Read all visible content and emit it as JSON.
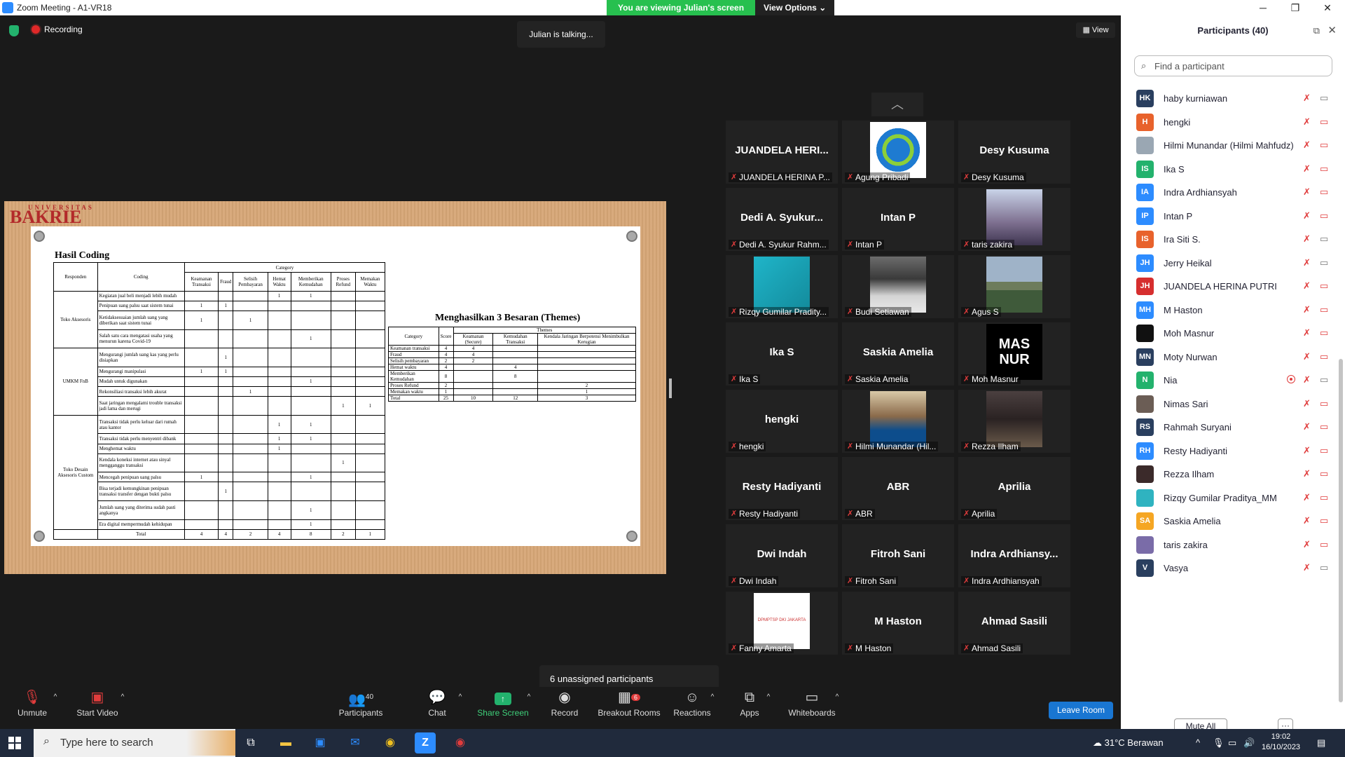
{
  "window": {
    "title": "Zoom Meeting - A1-VR18",
    "minimize": "─",
    "maximize": "❐",
    "close": "✕"
  },
  "banner": {
    "message": "You are viewing Julian's screen",
    "options_label": "View Options",
    "chevron": "⌄"
  },
  "topbar": {
    "recording": "Recording",
    "talking": "Julian is talking...",
    "view": "View"
  },
  "shared_screen": {
    "brand_small": "UNIVERSITAS",
    "brand_large": "BAKRIE",
    "coding_title": "Hasil Coding",
    "coding_headers": {
      "responden": "Responden",
      "coding": "Coding",
      "category": "Category"
    },
    "categories": [
      "Keamanan Transaksi",
      "Fraud",
      "Selisih Pembayaran",
      "Hemat Waktu",
      "Memberikan Kemudahan",
      "Proses Refund",
      "Memakan Waktu"
    ],
    "groups": [
      {
        "name": "Toko Aksesoris",
        "rows": [
          {
            "code": "Kegiatan jual beli menjadi lebih mudah",
            "v": [
              "",
              "",
              "",
              "1",
              "1",
              "",
              ""
            ]
          },
          {
            "code": "Penipuan uang palsu saat sistem tunai",
            "v": [
              "1",
              "1",
              "",
              "",
              "",
              "",
              ""
            ]
          },
          {
            "code": "Ketidaksesuaian jumlah uang yang diberikan saat sistem tunai",
            "v": [
              "1",
              "",
              "1",
              "",
              "",
              "",
              ""
            ]
          },
          {
            "code": "Salah satu cara mengatasi usaha yang menurun karena Covid-19",
            "v": [
              "",
              "",
              "",
              "",
              "1",
              "",
              ""
            ]
          }
        ]
      },
      {
        "name": "UMKM FnB",
        "rows": [
          {
            "code": "Mengurangi jumlah uang kas yang perlu disiapkan",
            "v": [
              "",
              "1",
              "",
              "",
              "",
              "",
              ""
            ]
          },
          {
            "code": "Mengurangi manipulasi",
            "v": [
              "1",
              "1",
              "",
              "",
              "",
              "",
              ""
            ]
          },
          {
            "code": "Mudah untuk digunakan",
            "v": [
              "",
              "",
              "",
              "",
              "1",
              "",
              ""
            ]
          },
          {
            "code": "Rekonsiliasi transaksi lebih akurat",
            "v": [
              "",
              "",
              "1",
              "",
              "",
              "",
              ""
            ]
          },
          {
            "code": "Saat jaringan mengalami trouble transaksi jadi lama dan merugi",
            "v": [
              "",
              "",
              "",
              "",
              "",
              "1",
              "1"
            ]
          }
        ]
      },
      {
        "name": "Toko Desain Aksesoris Custom",
        "rows": [
          {
            "code": "Transaksi tidak perlu keluar dari rumah atau kantor",
            "v": [
              "",
              "",
              "",
              "1",
              "1",
              "",
              ""
            ]
          },
          {
            "code": "Transaksi tidak perlu menyentri dibank",
            "v": [
              "",
              "",
              "",
              "1",
              "1",
              "",
              ""
            ]
          },
          {
            "code": "Menghemat waktu",
            "v": [
              "",
              "",
              "",
              "1",
              "",
              "",
              ""
            ]
          },
          {
            "code": "Kendala koneksi internet atau sinyal mengganggu transaksi",
            "v": [
              "",
              "",
              "",
              "",
              "",
              "1",
              ""
            ]
          },
          {
            "code": "Mencegah penipuan uang palsu",
            "v": [
              "1",
              "",
              "",
              "",
              "1",
              "",
              ""
            ]
          },
          {
            "code": "Bisa terjadi kemungkinan penipuan transaksi transfer dengan bukti palsu",
            "v": [
              "",
              "1",
              "",
              "",
              "",
              "",
              ""
            ]
          },
          {
            "code": "Jumlah uang yang diterima sudah pasti angkanya",
            "v": [
              "",
              "",
              "",
              "",
              "1",
              "",
              ""
            ]
          },
          {
            "code": "Era digital mempermudah kehidupan",
            "v": [
              "",
              "",
              "",
              "",
              "1",
              "",
              ""
            ]
          }
        ]
      }
    ],
    "total_label": "Total",
    "totals": [
      "4",
      "4",
      "2",
      "4",
      "8",
      "2",
      "1"
    ],
    "themes_title": "Menghasilkan 3 Besaran (Themes)",
    "themes_headers": {
      "category": "Category",
      "score": "Score",
      "themes": "Themes",
      "t1": "Keamanan (Secure)",
      "t2": "Kemudahan Transaksi",
      "t3": "Kendala Jaringan Berpotensi Menimbulkan Kerugian"
    },
    "themes_rows": [
      {
        "c": "Keamanan transaksi",
        "s": "4",
        "a": "4",
        "b": "",
        "d": ""
      },
      {
        "c": "Fraud",
        "s": "4",
        "a": "4",
        "b": "",
        "d": ""
      },
      {
        "c": "Selisih pembayaran",
        "s": "2",
        "a": "2",
        "b": "",
        "d": ""
      },
      {
        "c": "Hemat waktu",
        "s": "4",
        "a": "",
        "b": "4",
        "d": ""
      },
      {
        "c": "Memberikan Kemudahan",
        "s": "8",
        "a": "",
        "b": "8",
        "d": ""
      },
      {
        "c": "Proses Refund",
        "s": "2",
        "a": "",
        "b": "",
        "d": "2"
      },
      {
        "c": "Memakan waktu",
        "s": "1",
        "a": "",
        "b": "",
        "d": "1"
      },
      {
        "c": "Total",
        "s": "25",
        "a": "10",
        "b": "12",
        "d": "3"
      }
    ]
  },
  "tiles": [
    {
      "big": "JUANDELA HERI...",
      "label": "JUANDELA HERINA P...",
      "thumb": ""
    },
    {
      "big": "",
      "label": "Agung Pribadi",
      "thumb": "globe"
    },
    {
      "big": "Desy Kusuma",
      "label": "Desy Kusuma",
      "thumb": ""
    },
    {
      "big": "Dedi A. Syukur...",
      "label": "Dedi A. Syukur Rahm...",
      "thumb": ""
    },
    {
      "big": "Intan P",
      "label": "Intan P",
      "thumb": ""
    },
    {
      "big": "",
      "label": "taris zakira",
      "thumb": "group"
    },
    {
      "big": "",
      "label": "Rizqy Gumilar Pradity...",
      "thumb": "teal"
    },
    {
      "big": "",
      "label": "Budi Setiawan",
      "thumb": "person"
    },
    {
      "big": "",
      "label": "Agus S",
      "thumb": "field"
    },
    {
      "big": "Ika S",
      "label": "Ika S",
      "thumb": ""
    },
    {
      "big": "Saskia Amelia",
      "label": "Saskia Amelia",
      "thumb": ""
    },
    {
      "big": "",
      "label": "Moh Masnur",
      "thumb": "masnur"
    },
    {
      "big": "hengki",
      "label": "hengki",
      "thumb": ""
    },
    {
      "big": "",
      "label": "Hilmi Munandar (Hil...",
      "thumb": "person2"
    },
    {
      "big": "",
      "label": "Rezza Ilham",
      "thumb": "car"
    },
    {
      "big": "Resty Hadiyanti",
      "label": "Resty Hadiyanti",
      "thumb": ""
    },
    {
      "big": "ABR",
      "label": "ABR",
      "thumb": ""
    },
    {
      "big": "Aprilia",
      "label": "Aprilia",
      "thumb": ""
    },
    {
      "big": "Dwi Indah",
      "label": "Dwi Indah",
      "thumb": ""
    },
    {
      "big": "Fitroh Sani",
      "label": "Fitroh Sani",
      "thumb": ""
    },
    {
      "big": "Indra Ardhiansy...",
      "label": "Indra Ardhiansyah",
      "thumb": ""
    },
    {
      "big": "",
      "label": "Fanny Amarta",
      "thumb": "dpmptsp"
    },
    {
      "big": "M Haston",
      "label": "M Haston",
      "thumb": ""
    },
    {
      "big": "Ahmad Sasili",
      "label": "Ahmad Sasili",
      "thumb": ""
    }
  ],
  "dpmptsp_text": "DPMPTSP DKI JAKARTA",
  "masnur_text": "MAS NUR",
  "unassigned": "6 unassigned participants",
  "toolbar": {
    "unmute": "Unmute",
    "start_video": "Start Video",
    "participants": "Participants",
    "participants_count": "40",
    "chat": "Chat",
    "share": "Share Screen",
    "record": "Record",
    "breakout": "Breakout Rooms",
    "breakout_badge": "6",
    "reactions": "Reactions",
    "apps": "Apps",
    "whiteboards": "Whiteboards",
    "leave": "Leave Room"
  },
  "panel": {
    "title": "Participants (40)",
    "search_placeholder": "Find a participant",
    "mute_all": "Mute All",
    "more": "···",
    "participants": [
      {
        "initials": "HK",
        "name": "haby kurniawan",
        "color": "#2a3f5f",
        "cam": "off-grey"
      },
      {
        "initials": "H",
        "name": "hengki",
        "color": "#e8622c",
        "cam": "off"
      },
      {
        "initials": "",
        "name": "Hilmi Munandar (Hilmi Mahfudz)",
        "color": "#9aa7b3",
        "cam": "off"
      },
      {
        "initials": "IS",
        "name": "Ika S",
        "color": "#23b26d",
        "cam": "off"
      },
      {
        "initials": "IA",
        "name": "Indra Ardhiansyah",
        "color": "#2d8cff",
        "cam": "off"
      },
      {
        "initials": "IP",
        "name": "Intan P",
        "color": "#2d8cff",
        "cam": "off"
      },
      {
        "initials": "IS",
        "name": "Ira Siti S.",
        "color": "#e8622c",
        "cam": "off-grey"
      },
      {
        "initials": "JH",
        "name": "Jerry Heikal",
        "color": "#2d8cff",
        "cam": "off-grey"
      },
      {
        "initials": "JH",
        "name": "JUANDELA HERINA PUTRI",
        "color": "#d62e2e",
        "cam": "off"
      },
      {
        "initials": "MH",
        "name": "M Haston",
        "color": "#2d8cff",
        "cam": "off"
      },
      {
        "initials": "",
        "name": "Moh Masnur",
        "color": "#111111",
        "cam": "off"
      },
      {
        "initials": "MN",
        "name": "Moty Nurwan",
        "color": "#2a3f5f",
        "cam": "off"
      },
      {
        "initials": "N",
        "name": "Nia",
        "color": "#23b26d",
        "cam": "off-grey",
        "rec": true
      },
      {
        "initials": "",
        "name": "Nimas Sari",
        "color": "#6b5d55",
        "cam": "off"
      },
      {
        "initials": "RS",
        "name": "Rahmah Suryani",
        "color": "#2a3f5f",
        "cam": "off"
      },
      {
        "initials": "RH",
        "name": "Resty Hadiyanti",
        "color": "#2d8cff",
        "cam": "off"
      },
      {
        "initials": "",
        "name": "Rezza Ilham",
        "color": "#3b2a2a",
        "cam": "off"
      },
      {
        "initials": "",
        "name": "Rizqy Gumilar Praditya_MM",
        "color": "#2fb3c0",
        "cam": "off"
      },
      {
        "initials": "SA",
        "name": "Saskia Amelia",
        "color": "#f5a623",
        "cam": "off"
      },
      {
        "initials": "",
        "name": "taris zakira",
        "color": "#7a6ca8",
        "cam": "off"
      },
      {
        "initials": "V",
        "name": "Vasya",
        "color": "#2a3f5f",
        "cam": "off-grey"
      }
    ]
  },
  "taskbar": {
    "search_placeholder": "Type here to search",
    "weather": "31°C Berawan",
    "time": "19:02",
    "date": "16/10/2023"
  },
  "colors": {
    "accent": "#2d8cff",
    "green": "#27c04f",
    "muted_red": "#e03c3c"
  }
}
